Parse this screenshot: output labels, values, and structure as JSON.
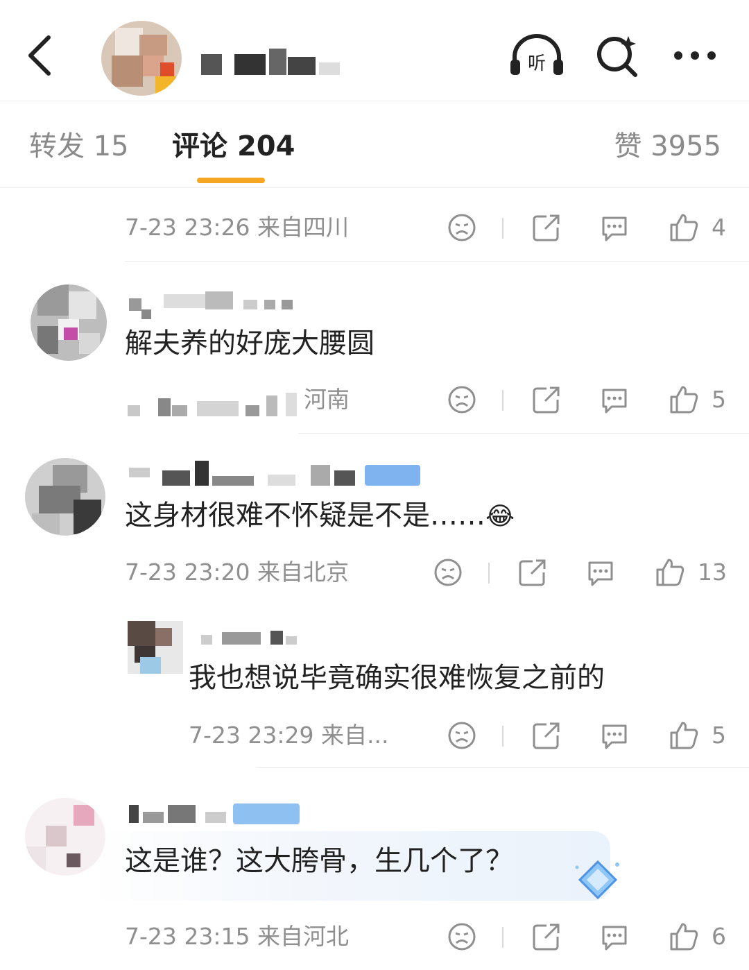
{
  "header": {
    "icons": [
      "back-icon",
      "listen-icon",
      "search-icon",
      "more-icon"
    ],
    "listen_label": "听"
  },
  "tabs": {
    "repost": {
      "label": "转发",
      "count": "15"
    },
    "comment": {
      "label": "评论",
      "count": "204"
    },
    "like": {
      "label": "赞",
      "count": "3955"
    },
    "active": "comment",
    "accent_color": "#f5a623"
  },
  "comments": [
    {
      "meta": "7-23 23:26 来自四川",
      "likes": "4"
    },
    {
      "content": "解夫养的好庞大腰圆",
      "meta_location": "河南",
      "likes": "5"
    },
    {
      "content": "这身材很难不怀疑是不是……",
      "emoji": "😂",
      "meta": "7-23 23:20 来自北京",
      "likes": "13"
    },
    {
      "content": "我也想说毕竟确实很难恢复之前的",
      "meta": "7-23 23:29 来自...",
      "likes": "5"
    },
    {
      "content": "这是谁？这大胯骨，生几个了？",
      "meta": "7-23 23:15 来自河北",
      "likes": "6"
    }
  ]
}
